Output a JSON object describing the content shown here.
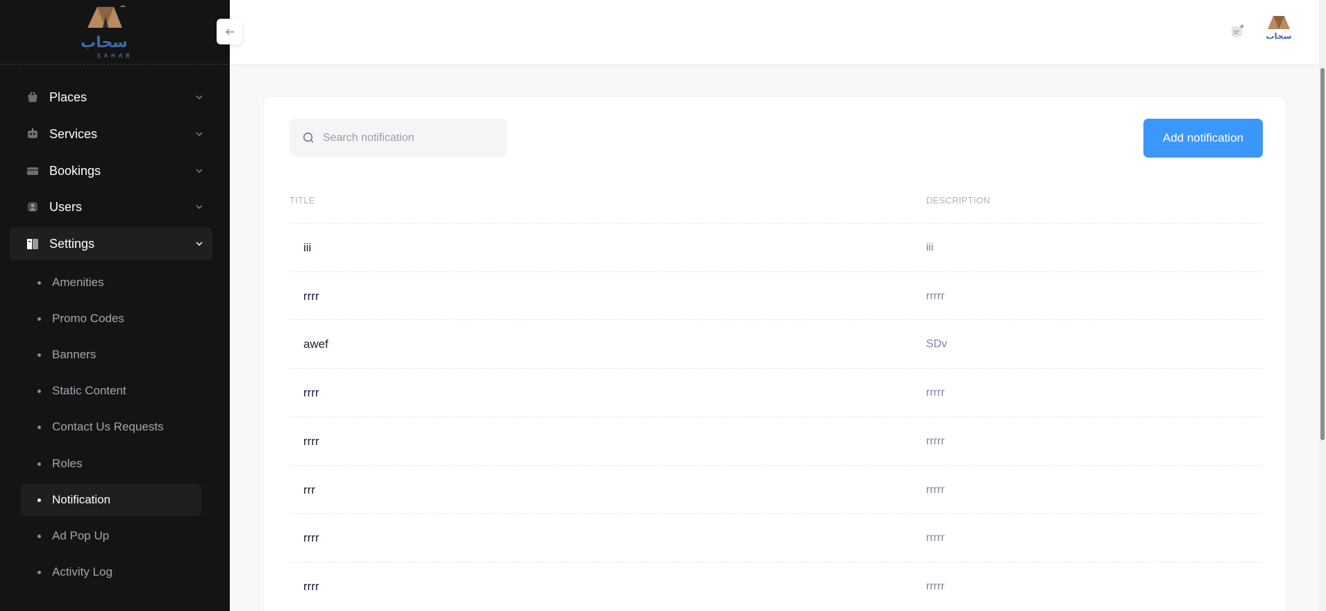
{
  "brand": {
    "logo_text": "سحاب",
    "logo_sub": "SAHAB"
  },
  "sidebar": {
    "items": [
      {
        "label": "Places",
        "icon": "basket-icon"
      },
      {
        "label": "Services",
        "icon": "robot-icon"
      },
      {
        "label": "Bookings",
        "icon": "card-icon"
      },
      {
        "label": "Users",
        "icon": "user-icon"
      },
      {
        "label": "Settings",
        "icon": "book-icon"
      }
    ],
    "settings_sub": [
      {
        "label": "Amenities"
      },
      {
        "label": "Promo Codes"
      },
      {
        "label": "Banners"
      },
      {
        "label": "Static Content"
      },
      {
        "label": "Contact Us Requests"
      },
      {
        "label": "Roles"
      },
      {
        "label": "Notification"
      },
      {
        "label": "Ad Pop Up"
      },
      {
        "label": "Activity Log"
      }
    ],
    "active_item": "Settings",
    "active_sub": "Notification"
  },
  "search": {
    "placeholder": "Search notification",
    "value": ""
  },
  "add_button": {
    "label": "Add notification"
  },
  "table": {
    "headers": {
      "title": "TITLE",
      "description": "DESCRIPTION"
    },
    "rows": [
      {
        "title": "iii",
        "description": "iii"
      },
      {
        "title": "rrrr",
        "description": "rrrrr"
      },
      {
        "title": "awef",
        "description": "SDv"
      },
      {
        "title": "rrrr",
        "description": "rrrrr"
      },
      {
        "title": "rrrr",
        "description": "rrrrr"
      },
      {
        "title": "rrr",
        "description": "rrrrr"
      },
      {
        "title": "rrrr",
        "description": "rrrrr"
      },
      {
        "title": "rrrr",
        "description": "rrrrr"
      }
    ]
  },
  "colors": {
    "sidebar_bg": "#141414",
    "accent": "#3b97f9",
    "page_bg": "#f8f8fa"
  }
}
